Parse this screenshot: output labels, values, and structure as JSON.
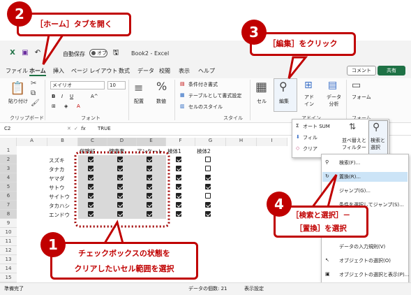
{
  "callouts": {
    "c1": {
      "num": "1",
      "line1": "チェックボックスの状態を",
      "line2": "クリアしたいセル範囲を選択"
    },
    "c2": {
      "num": "2",
      "text": "［ホーム］タブを開く"
    },
    "c3": {
      "num": "3",
      "text": "［編集］をクリック"
    },
    "c4": {
      "num": "4",
      "line1": "［検索と選択］－",
      "line2": "［置換］を選択"
    }
  },
  "titlebar": {
    "autosave": "自動保存",
    "toggle": "オフ",
    "title": "Book2 - Excel"
  },
  "menu": {
    "items": [
      "ファイル",
      "ホーム",
      "挿入",
      "ページ レイアウト",
      "数式",
      "データ",
      "校閲",
      "表示",
      "ヘルプ"
    ],
    "comment": "コメント",
    "share": "共有"
  },
  "ribbon": {
    "paste": "貼り付け",
    "clipboard": "クリップボード",
    "font_name": "メイリオ",
    "font_size": "10",
    "font_group": "フォント",
    "align": "配置",
    "number": "数値",
    "cond_format": "条件付き書式",
    "table_format": "テーブルとして書式設定",
    "cell_style": "セルのスタイル",
    "style_group": "スタイル",
    "cells": "セル",
    "edit": "編集",
    "addin": "アド\nイン",
    "addin_group": "アドイン",
    "data_analysis": "データ\n分析",
    "form": "フォーム",
    "form_group": "フォーム"
  },
  "formula": {
    "namebox": "C2",
    "fx": "fx",
    "value": "TRUE"
  },
  "grid": {
    "cols": [
      "A",
      "B",
      "C",
      "D",
      "E",
      "F",
      "G",
      "H",
      "I"
    ],
    "rows": [
      "1",
      "2",
      "3",
      "4",
      "5",
      "6",
      "7",
      "8",
      "9",
      "10",
      "11",
      "12",
      "13",
      "14",
      "15"
    ],
    "headers": [
      "保険証",
      "健康表",
      "アンケート",
      "検体1",
      "検体2"
    ],
    "names": [
      "スズキ",
      "タナカ",
      "ヤマダ",
      "サトウ",
      "サイトウ",
      "タカハシ",
      "エンドウ"
    ],
    "checks": [
      [
        true,
        true,
        true,
        true,
        false
      ],
      [
        true,
        true,
        true,
        true,
        false
      ],
      [
        true,
        true,
        true,
        true,
        true
      ],
      [
        true,
        true,
        true,
        true,
        true
      ],
      [
        true,
        true,
        true,
        true,
        false
      ],
      [
        true,
        true,
        true,
        true,
        true
      ],
      [
        true,
        true,
        true,
        true,
        true
      ]
    ]
  },
  "edit_popup": {
    "autosum": "オート SUM",
    "fill": "フィル",
    "clear": "クリア",
    "sort": "並べ替えと\nフィルター",
    "find_select": "検索と\n選択"
  },
  "dropdown": [
    {
      "label": "検索(F)...",
      "icon": "search-icon"
    },
    {
      "label": "置換(R)...",
      "icon": "replace-icon"
    },
    {
      "label": "ジャンプ(G)...",
      "icon": "jump-icon"
    },
    {
      "label": "条件を選択してジャンプ(S)...",
      "icon": ""
    },
    {
      "label": "(C)",
      "icon": ""
    },
    {
      "label": "定数(N)",
      "icon": ""
    },
    {
      "label": "データの入力規則(V)",
      "icon": ""
    },
    {
      "label": "オブジェクトの選択(O)",
      "icon": "pointer-icon"
    },
    {
      "label": "オブジェクトの選択と表示(P)...",
      "icon": "selection-pane-icon"
    }
  ],
  "status": {
    "ready": "準備完了",
    "count": "データの個数: 21",
    "display": "表示設定"
  },
  "colors": {
    "accent": "#c00000",
    "excel": "#1e7145"
  }
}
